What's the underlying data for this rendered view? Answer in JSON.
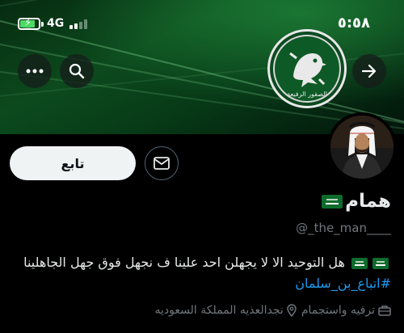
{
  "status": {
    "time": "٥:٥٨",
    "network": "4G",
    "battery_color": "#4cd964"
  },
  "header": {
    "logo_text": "الصقور الرفيعة",
    "back_icon": "arrow-right-icon",
    "search_icon": "search-icon",
    "more_icon": "more-horizontal-icon"
  },
  "actions": {
    "follow_label": "تابع",
    "message_icon": "mail-icon"
  },
  "profile": {
    "display_name": "همام",
    "handle": "@_the_man____",
    "bio_text": "هل التوحيد الا لا يجهلن احد علينا ف نجهل فوق جهل الجاهلينا",
    "bio_hashtag": "#اتباع_بن_سلمان",
    "category": "ترفيه واستجمام",
    "location": "نجدالعذيه المملكة السعوديه",
    "accent": "#1d9bf0"
  }
}
